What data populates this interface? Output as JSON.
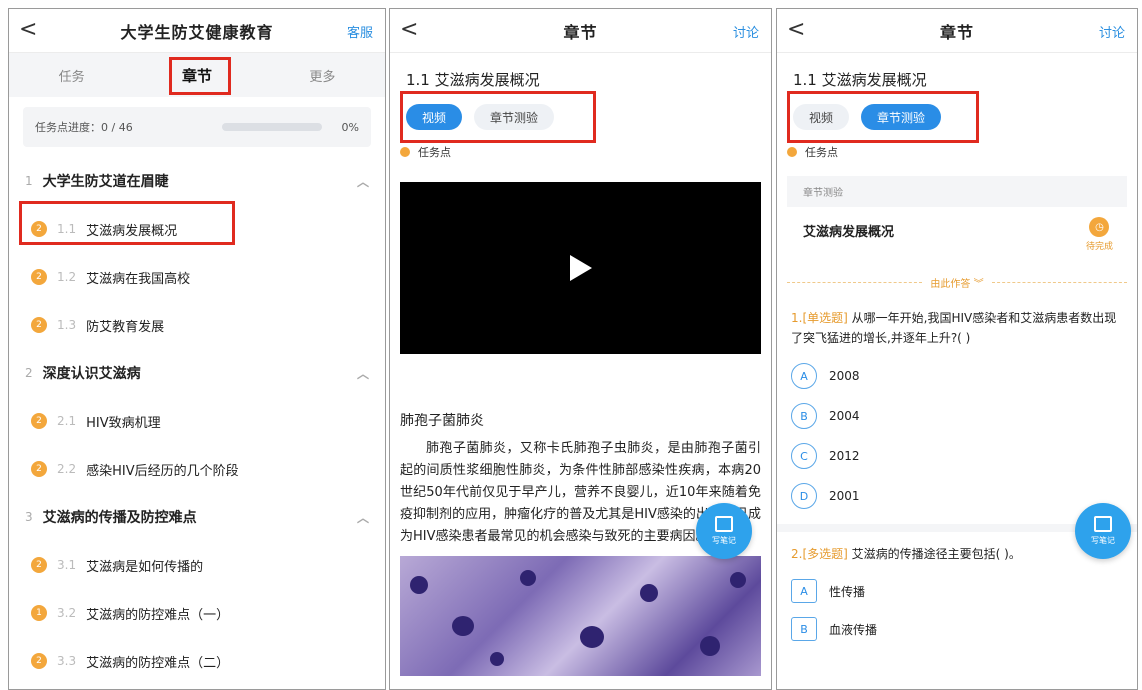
{
  "panel1": {
    "header": {
      "back": "<",
      "title": "大学生防艾健康教育",
      "right": "客服"
    },
    "tabs": [
      "任务",
      "章节",
      "更多"
    ],
    "progress": {
      "label": "任务点进度：0 / 46",
      "percent": "0%",
      "fraction": 0
    },
    "sections": [
      {
        "num": "1",
        "title": "大学生防艾道在眉睫",
        "chevron": "︿",
        "lessons": [
          {
            "badge": "2",
            "num": "1.1",
            "title": "艾滋病发展概况"
          },
          {
            "badge": "2",
            "num": "1.2",
            "title": "艾滋病在我国高校"
          },
          {
            "badge": "2",
            "num": "1.3",
            "title": "防艾教育发展"
          }
        ]
      },
      {
        "num": "2",
        "title": "深度认识艾滋病",
        "chevron": "︿",
        "lessons": [
          {
            "badge": "2",
            "num": "2.1",
            "title": "HIV致病机理"
          },
          {
            "badge": "2",
            "num": "2.2",
            "title": "感染HIV后经历的几个阶段"
          }
        ]
      },
      {
        "num": "3",
        "title": "艾滋病的传播及防控难点",
        "chevron": "︿",
        "lessons": [
          {
            "badge": "2",
            "num": "3.1",
            "title": "艾滋病是如何传播的"
          },
          {
            "badge": "1",
            "num": "3.2",
            "title": "艾滋病的防控难点（一）"
          },
          {
            "badge": "2",
            "num": "3.3",
            "title": "艾滋病的防控难点（二）"
          }
        ]
      }
    ]
  },
  "panel2": {
    "header": {
      "back": "<",
      "title": "章节",
      "right": "讨论"
    },
    "chapter_title": "1.1 艾滋病发展概况",
    "pills": [
      "视频",
      "章节测验"
    ],
    "task_point": "任务点",
    "article_heading": "肺孢子菌肺炎",
    "article_body": "肺孢子菌肺炎，又称卡氏肺孢子虫肺炎，是由肺孢子菌引起的间质性浆细胞性肺炎，为条件性肺部感染性疾病，本病20世纪50年代前仅见于早产儿，营养不良婴儿，近10年来随着免疫抑制剂的应用，肿瘤化疗的普及尤其是HIV感染的出现，已成为HIV感染患者最常见的机会感染与致死的主要病因。",
    "fab_label": "写笔记"
  },
  "panel3": {
    "header": {
      "back": "<",
      "title": "章节",
      "right": "讨论"
    },
    "chapter_title": "1.1 艾滋病发展概况",
    "pills": [
      "视频",
      "章节测验"
    ],
    "task_point": "任务点",
    "quiz_label": "章节测验",
    "quiz_title": "艾滋病发展概况",
    "status": "待完成",
    "divider": "由此作答 ︾",
    "q1": {
      "tag": "1.[单选题]",
      "text": "从哪一年开始,我国HIV感染者和艾滋病患者数出现了突飞猛进的增长,并逐年上升?( )",
      "options": [
        {
          "key": "A",
          "text": "2008"
        },
        {
          "key": "B",
          "text": "2004"
        },
        {
          "key": "C",
          "text": "2012"
        },
        {
          "key": "D",
          "text": "2001"
        }
      ]
    },
    "q2": {
      "tag": "2.[多选题]",
      "text": "艾滋病的传播途径主要包括( )。",
      "options": [
        {
          "key": "A",
          "text": "性传播"
        },
        {
          "key": "B",
          "text": "血液传播"
        }
      ]
    },
    "fab_label": "写笔记"
  },
  "colors": {
    "accent": "#2a8de6",
    "highlight": "#e02a1f",
    "badge": "#f3a73c"
  }
}
